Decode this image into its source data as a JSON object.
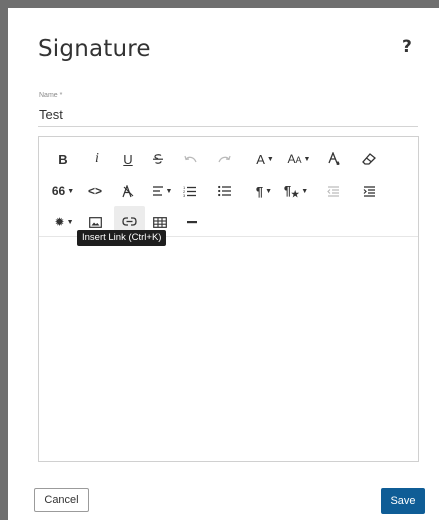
{
  "dialog": {
    "title": "Signature",
    "help_icon": "?",
    "name_label": "Name *",
    "name_value": "Test",
    "tooltip": "Insert Link (Ctrl+K)",
    "cancel_label": "Cancel",
    "save_label": "Save"
  },
  "toolbar": {
    "bold": "B",
    "italic": "i",
    "underline": "U",
    "font_color": "A",
    "font_size": "AA",
    "paragraph": "¶",
    "quote": "66",
    "code": "<>"
  },
  "colors": {
    "save_button": "#0f5d96",
    "tooltip_bg": "#1e1e1e",
    "backdrop": "#6f6f6f"
  },
  "icons": [
    "bold-icon",
    "italic-icon",
    "underline-icon",
    "strikethrough-icon",
    "undo-icon",
    "redo-icon",
    "font-color-icon",
    "font-size-icon",
    "highlight-icon",
    "eraser-icon",
    "quote-icon",
    "code-icon",
    "clear-format-icon",
    "align-icon",
    "numbered-list-icon",
    "bullet-list-icon",
    "paragraph-icon",
    "paragraph-style-icon",
    "outdent-icon",
    "indent-icon",
    "more-options-icon",
    "image-icon",
    "link-icon",
    "table-icon",
    "horizontal-rule-icon"
  ]
}
